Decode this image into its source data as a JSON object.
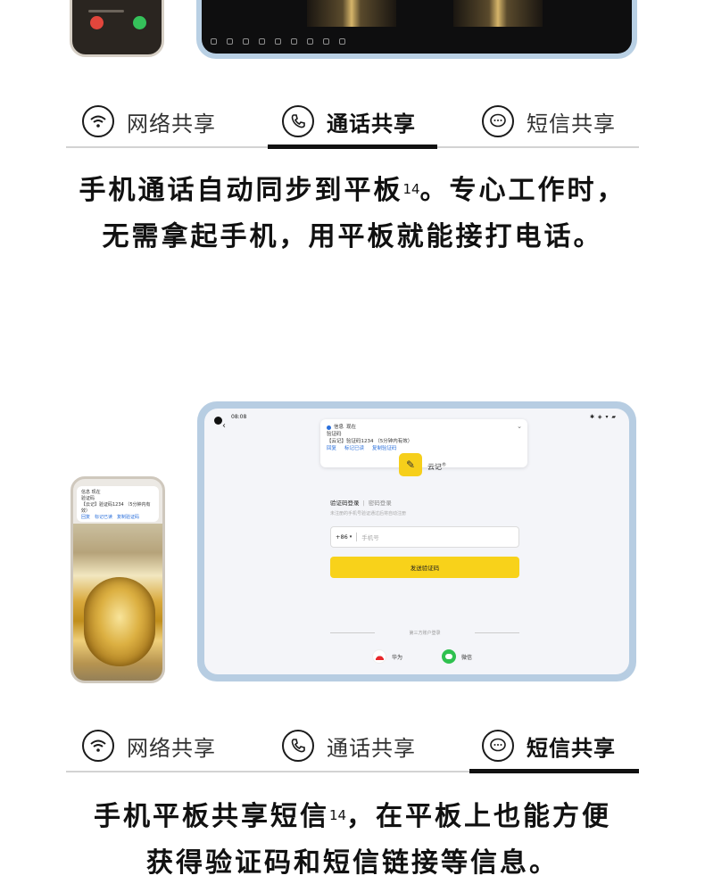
{
  "top_section": {
    "tabs": [
      {
        "label": "网络共享",
        "active": false
      },
      {
        "label": "通话共享",
        "active": true
      },
      {
        "label": "短信共享",
        "active": false
      }
    ],
    "description_line1": "手机通话自动同步到平板",
    "description_sup": "14",
    "description_line1_tail": "。专心工作时，",
    "description_line2": "无需拿起手机，用平板就能接打电话。"
  },
  "bottom_section": {
    "tabs": [
      {
        "label": "网络共享",
        "active": false
      },
      {
        "label": "通话共享",
        "active": false
      },
      {
        "label": "短信共享",
        "active": true
      }
    ],
    "description_line1": "手机平板共享短信",
    "description_sup": "14",
    "description_line1_tail": "，在平板上也能方便",
    "description_line2": "获得验证码和短信链接等信息。"
  },
  "tablet_ui": {
    "status_time": "08:08",
    "status_icons": "✱ ◈ ▾ ▰",
    "notification": {
      "app": "信息",
      "app_tag": "现在",
      "title": "验证码",
      "body": "【云记】验证码1234 （5分钟内有效）",
      "actions": [
        "回复",
        "标记已读",
        "复制验证码"
      ]
    },
    "app_name": "云记",
    "app_mark": "®",
    "login_tab_active": "验证码登录",
    "login_tab_other": "密码登录",
    "login_hint": "未注册的手机号验证通过后将自动注册",
    "country_code": "+86",
    "phone_placeholder": "手机号",
    "send_button": "发送验证码",
    "third_party_label": "第三方账户登录",
    "sso_huawei": "华为",
    "sso_wechat": "微信"
  },
  "phone_ui": {
    "notification": {
      "app": "信息",
      "app_tag": "现在",
      "title": "验证码",
      "body": "【云记】验证码1234 （5分钟内有效）",
      "actions": [
        "回复",
        "标记已读",
        "复制验证码"
      ]
    }
  },
  "colors": {
    "accent_yellow": "#f8d21a",
    "indicator": "#111111",
    "link_blue": "#2a6fdb"
  },
  "icons": {
    "tab1": "wifi-icon",
    "tab2": "phone-call-icon",
    "tab3": "message-icon"
  }
}
